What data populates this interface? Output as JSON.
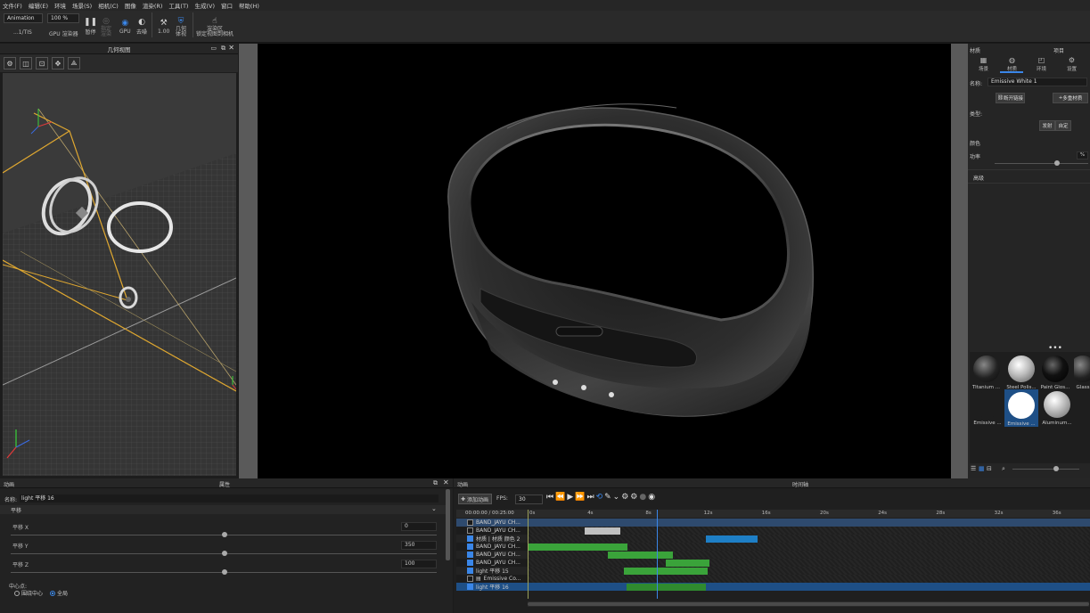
{
  "menu": [
    "文件(F)",
    "编辑(E)",
    "环境",
    "场景(S)",
    "相机(C)",
    "图像",
    "渲染(R)",
    "工具(T)",
    "生成(V)",
    "窗口",
    "帮助(H)"
  ],
  "toolbar": {
    "preset_select": "Animation",
    "zoom_select": "100 %",
    "preset_label": "...1/TIS",
    "gpu_label_left": "GPU 渲染器",
    "pause_label": "暂停",
    "render_label": "指定\n渲染",
    "gpu_label": "GPU",
    "shade_label": "去噪",
    "tool_label": "1.00",
    "region_label": "几何\n体视",
    "lock_label": "渲染区\n锁定视图到相机"
  },
  "geo_panel": {
    "title": "几何视图"
  },
  "right_panel": {
    "col1": "材质",
    "col2": "项目",
    "tabs": [
      "场景",
      "材质",
      "环境",
      "设置"
    ],
    "name_label": "名称:",
    "name_value": "Emissive White 1",
    "btn_link": "断开链接",
    "btn_multi": "多重材质",
    "type_label": "类型:",
    "btn_type_a": "发射",
    "btn_type_b": "自定",
    "color_label": "颜色",
    "intensity_label": "功率",
    "intensity_unit": "%",
    "section_label": "高级",
    "materials": [
      {
        "name": "Titanium ...",
        "color": "#2a2a2a"
      },
      {
        "name": "Steel Polis...",
        "color": "#cfcfcf"
      },
      {
        "name": "Paint Glos...",
        "color": "#0a0a0a"
      },
      {
        "name": "Glass",
        "color": "#444444"
      },
      {
        "name": "Emissive ...",
        "color": "#1a1a1a"
      },
      {
        "name": "Emissive ...",
        "color": "#ffffff"
      },
      {
        "name": "Aluminum...",
        "color": "#d0d0d0"
      }
    ]
  },
  "props": {
    "title_left": "动画",
    "title": "属性",
    "name_label": "名称:",
    "name_value": "light 平移 16",
    "section": "平移",
    "rows": [
      {
        "label": "平移 X",
        "value": "0"
      },
      {
        "label": "平移 Y",
        "value": "350"
      },
      {
        "label": "平移 Z",
        "value": "100"
      }
    ],
    "pivot_label": "中心点:",
    "radio_a": "围绕中心",
    "radio_b": "全局"
  },
  "timeline": {
    "title_left": "动画",
    "title": "时间轴",
    "add_btn": "添加动画",
    "fps_label": "FPS:",
    "fps_value": "30",
    "header_label": "00:00:00 / 00:25:00",
    "ticks": [
      "0s",
      "4s",
      "8s",
      "12s",
      "16s",
      "20s",
      "24s",
      "28s",
      "32s",
      "36s"
    ],
    "tracks": [
      {
        "name": "BAND_JAYU CH...",
        "checked": false,
        "type": "header"
      },
      {
        "name": "BAND_JAYU CH...",
        "checked": false,
        "type": "normal"
      },
      {
        "name": "材质 | 材质 颜色 2",
        "checked": true,
        "type": "normal"
      },
      {
        "name": "BAND_JAYU CH...",
        "checked": true,
        "type": "normal"
      },
      {
        "name": "BAND_JAYU CH...",
        "checked": true,
        "type": "normal"
      },
      {
        "name": "BAND_JAYU CH...",
        "checked": true,
        "type": "normal"
      },
      {
        "name": "light 平移 15",
        "checked": true,
        "type": "normal"
      },
      {
        "name": "Emissive Co...",
        "checked": false,
        "type": "folder"
      },
      {
        "name": "light 平移 16",
        "checked": true,
        "type": "selected"
      }
    ]
  },
  "colors": {
    "accent": "#3a86e8",
    "green": "#3aa33a",
    "blue": "#1e7fc6",
    "gray": "#c0c0c0"
  }
}
